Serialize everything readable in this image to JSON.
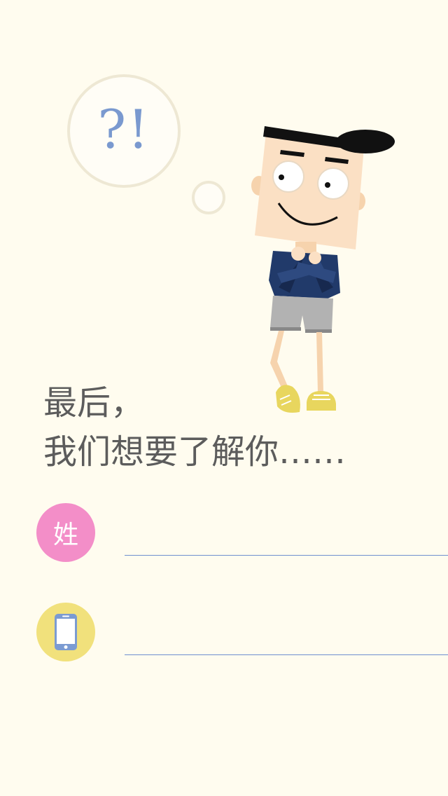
{
  "thought_bubble": {
    "text": "?!"
  },
  "heading": {
    "line1": "最后，",
    "line2": "我们想要了解你……"
  },
  "form": {
    "surname": {
      "icon_text": "姓",
      "icon": "surname-icon",
      "value": "",
      "placeholder": ""
    },
    "phone": {
      "icon": "phone-icon",
      "value": "",
      "placeholder": ""
    }
  },
  "colors": {
    "background": "#fffcef",
    "question_mark": "#7a99cf",
    "surname_circle": "#f38ec8",
    "phone_circle": "#f1e17c",
    "input_underline": "#6f8fcf",
    "heading_text": "#5c5c5c"
  }
}
